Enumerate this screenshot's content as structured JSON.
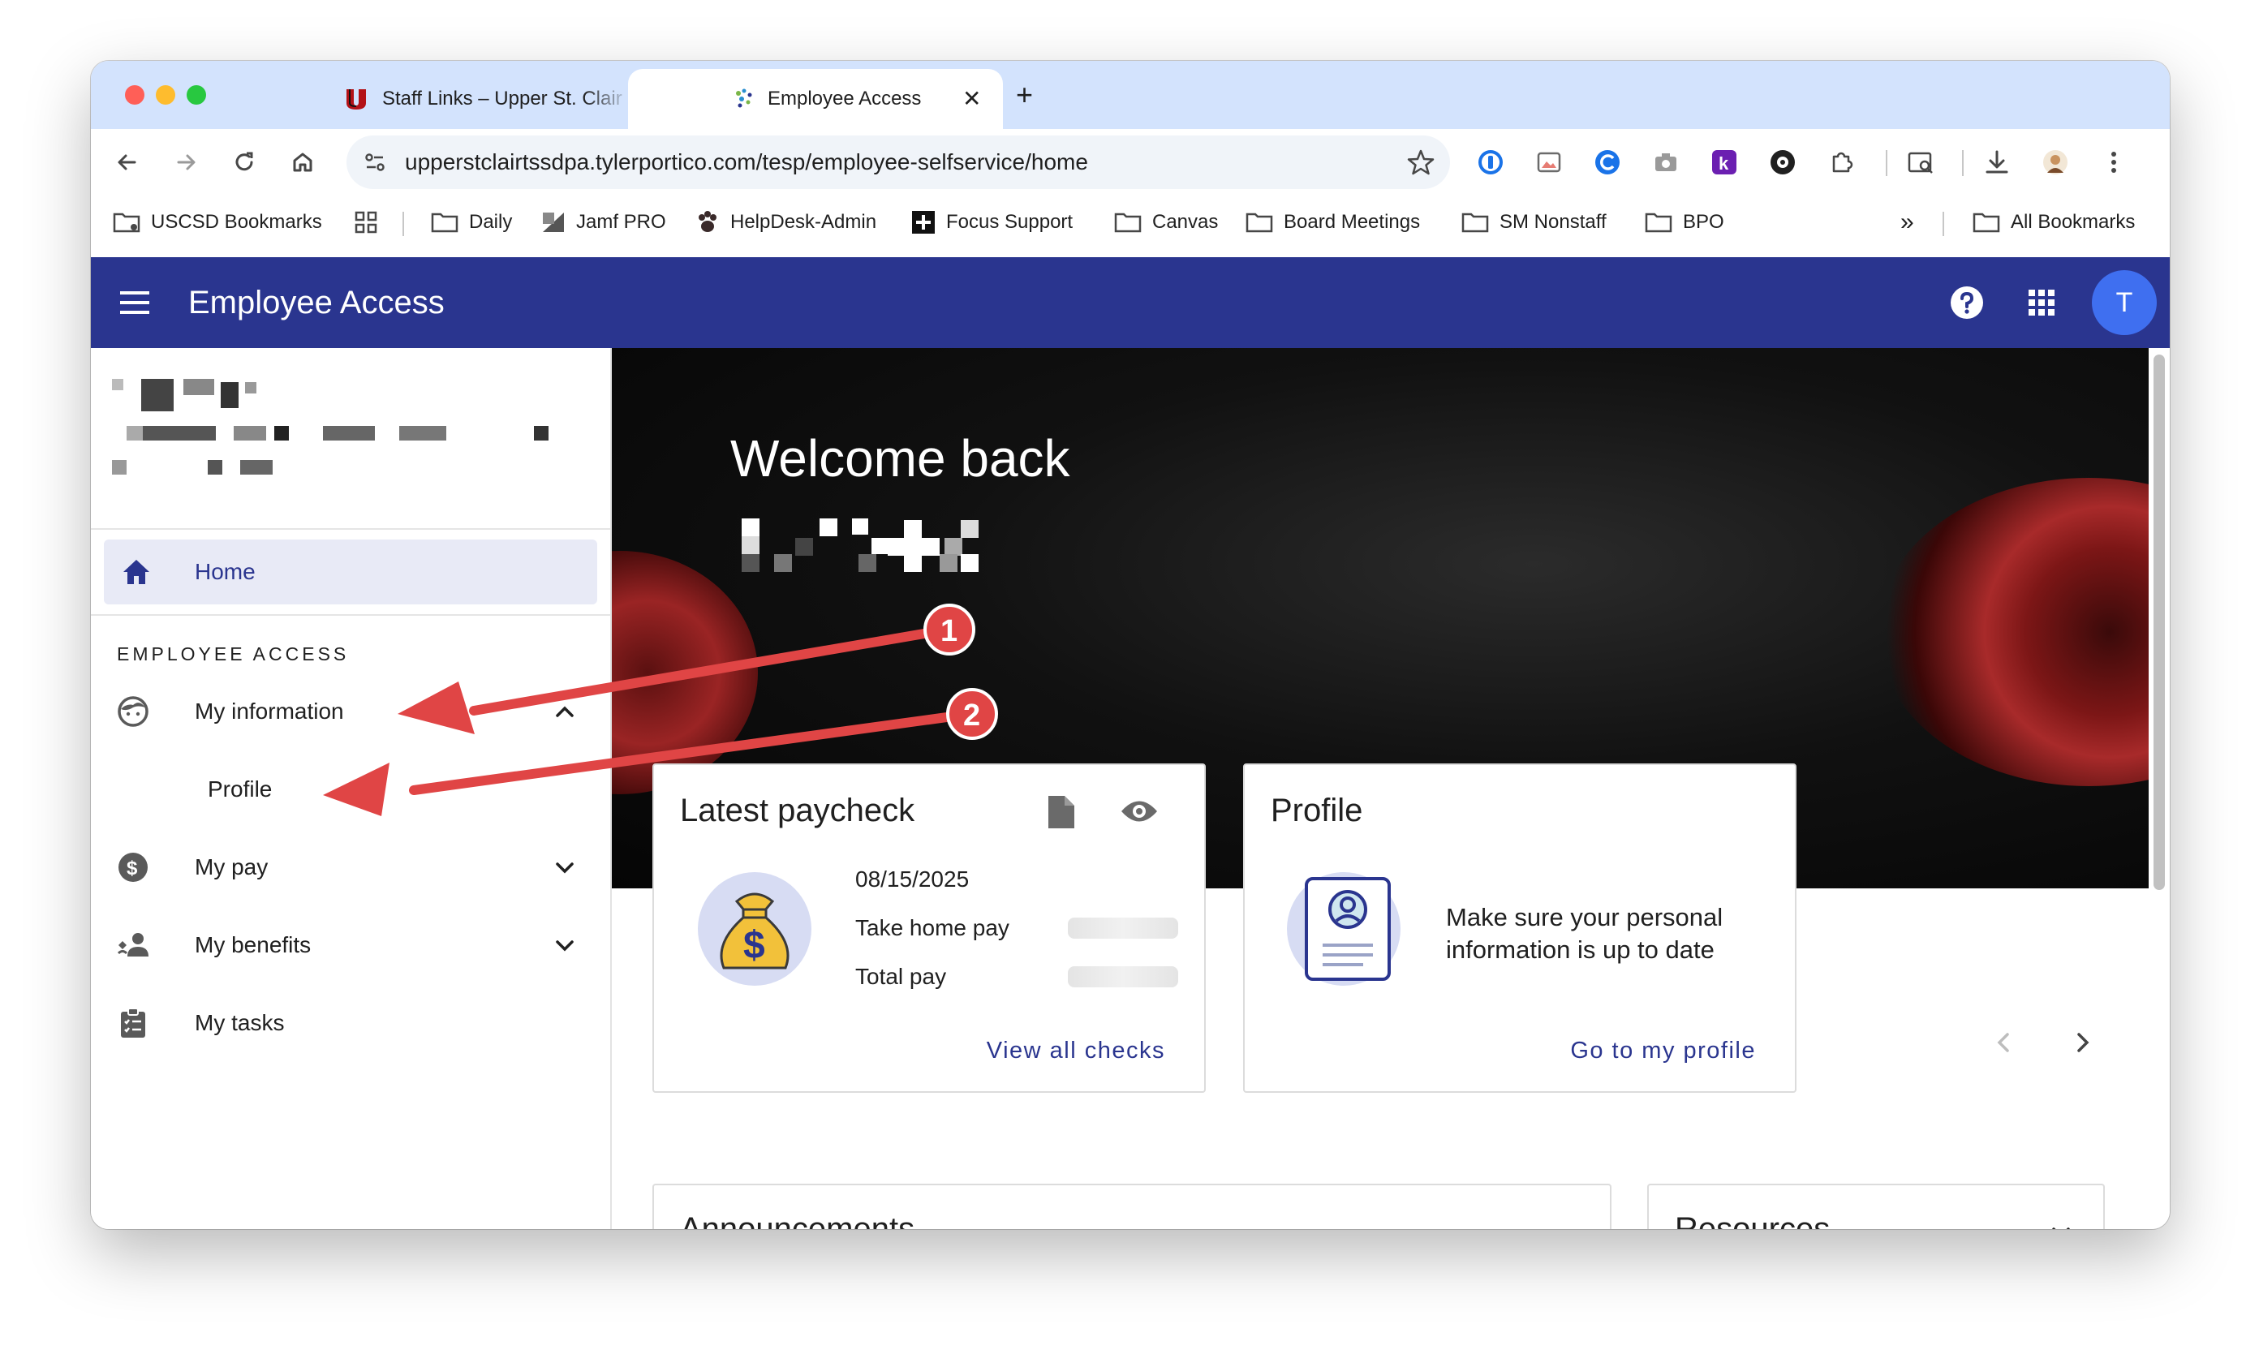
{
  "browser": {
    "tabs": [
      {
        "title": "Staff Links – Upper St. Clair S",
        "favicon": "upper-st-clair-logo",
        "active": false
      },
      {
        "title": "Employee Access",
        "favicon": "tyler-logo",
        "active": true
      }
    ],
    "url": "upperstclairtssdpa.tylerportico.com/tesp/employee-selfservice/home",
    "bookmarks": [
      {
        "label": "USCSD Bookmarks",
        "icon": "folder-icon"
      },
      {
        "label": "",
        "icon": "apps-grid-icon"
      },
      {
        "label": "Daily",
        "icon": "folder-icon"
      },
      {
        "label": "Jamf PRO",
        "icon": "jamf-icon"
      },
      {
        "label": "HelpDesk-Admin",
        "icon": "paw-icon"
      },
      {
        "label": "Focus Support",
        "icon": "plus-square-icon"
      },
      {
        "label": "Canvas",
        "icon": "folder-icon"
      },
      {
        "label": "Board Meetings",
        "icon": "folder-icon"
      },
      {
        "label": "SM Nonstaff",
        "icon": "folder-icon"
      },
      {
        "label": "BPO",
        "icon": "folder-icon"
      }
    ],
    "all_bookmarks": "All Bookmarks",
    "more_bookmarks": "»"
  },
  "app": {
    "title": "Employee Access",
    "avatar_letter": "T",
    "brand_color": "#2a358f"
  },
  "sidebar": {
    "home": "Home",
    "section_title": "EMPLOYEE ACCESS",
    "items": [
      {
        "label": "My information",
        "icon": "face-icon",
        "expanded": true
      },
      {
        "label": "Profile",
        "icon": "",
        "sub": true
      },
      {
        "label": "My pay",
        "icon": "dollar-circle-icon",
        "expanded": false
      },
      {
        "label": "My benefits",
        "icon": "people-icon",
        "expanded": false
      },
      {
        "label": "My tasks",
        "icon": "clipboard-list-icon"
      }
    ]
  },
  "main": {
    "welcome": "Welcome back",
    "paycheck_card": {
      "title": "Latest paycheck",
      "date": "08/15/2025",
      "take_home_label": "Take home pay",
      "total_label": "Total pay",
      "link": "View all checks"
    },
    "profile_card": {
      "title": "Profile",
      "text": "Make sure your personal information is up to date",
      "link": "Go to my profile"
    },
    "announcements_title": "Announcements",
    "resources_title": "Resources"
  },
  "annotations": {
    "color": "#e04545",
    "badges": [
      "1",
      "2"
    ]
  }
}
